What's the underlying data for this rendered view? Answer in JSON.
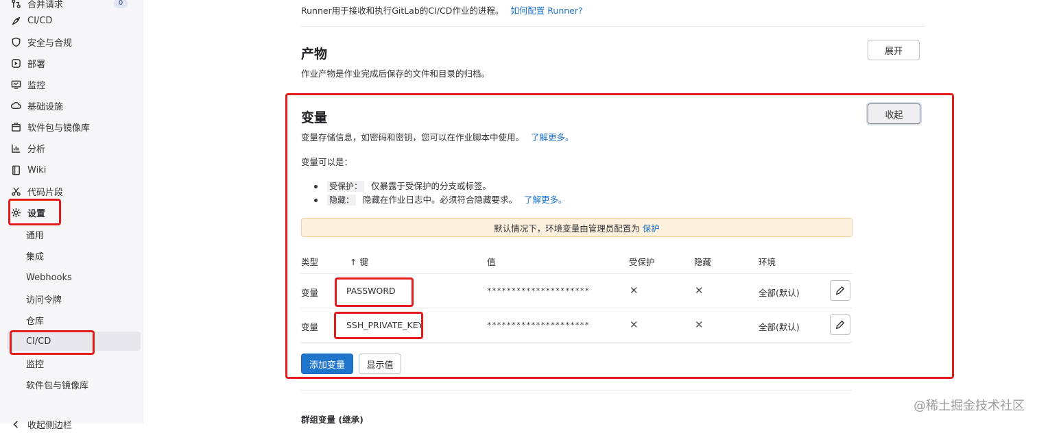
{
  "sidebar": {
    "top_partial": "合并请求",
    "top_badge": "0",
    "items": [
      {
        "label": "CI/CD",
        "icon": "rocket-icon"
      },
      {
        "label": "安全与合规",
        "icon": "shield-icon"
      },
      {
        "label": "部署",
        "icon": "deploy-icon"
      },
      {
        "label": "监控",
        "icon": "monitor-icon"
      },
      {
        "label": "基础设施",
        "icon": "cloud-icon"
      },
      {
        "label": "软件包与镜像库",
        "icon": "package-icon"
      },
      {
        "label": "分析",
        "icon": "chart-icon"
      },
      {
        "label": "Wiki",
        "icon": "book-icon"
      },
      {
        "label": "代码片段",
        "icon": "scissors-icon"
      },
      {
        "label": "设置",
        "icon": "gear-icon"
      }
    ],
    "sub_items": [
      "通用",
      "集成",
      "Webhooks",
      "访问令牌",
      "仓库",
      "CI/CD",
      "监控",
      "软件包与镜像库"
    ],
    "bottom_partial": "收起侧边栏"
  },
  "runner": {
    "text": "Runner用于接收和执行GitLab的CI/CD作业的进程。",
    "link": "如何配置 Runner?"
  },
  "artifacts": {
    "title": "产物",
    "desc": "作业产物是作业完成后保存的文件和目录的归档。",
    "button": "展开"
  },
  "variables": {
    "title": "变量",
    "button": "收起",
    "desc": "变量存储信息，如密码和密钥，您可以在作业脚本中使用。",
    "desc_link": "了解更多。",
    "can_be": "变量可以是：",
    "bullets": [
      {
        "term": "受保护：",
        "text": "仅暴露于受保护的分支或标签。",
        "link": ""
      },
      {
        "term": "隐藏：",
        "text": "隐藏在作业日志中。必须符合隐藏要求。",
        "link": "了解更多。"
      }
    ],
    "alert_text": "默认情况下，环境变量由管理员配置为",
    "alert_link": "保护",
    "columns": {
      "type": "类型",
      "key": "↑ 键",
      "value": "值",
      "protected": "受保护",
      "masked": "隐藏",
      "env": "环境"
    },
    "rows": [
      {
        "type": "变量",
        "key": "PASSWORD",
        "value": "*********************",
        "protected": "✕",
        "masked": "✕",
        "env": "全部(默认)"
      },
      {
        "type": "变量",
        "key": "SSH_PRIVATE_KEY",
        "value": "*********************",
        "protected": "✕",
        "masked": "✕",
        "env": "全部(默认)"
      }
    ],
    "add_button": "添加变量",
    "reveal_button": "显示值"
  },
  "group_vars": {
    "title": "群组变量 (继承)"
  },
  "watermark": "@稀土掘金技术社区"
}
